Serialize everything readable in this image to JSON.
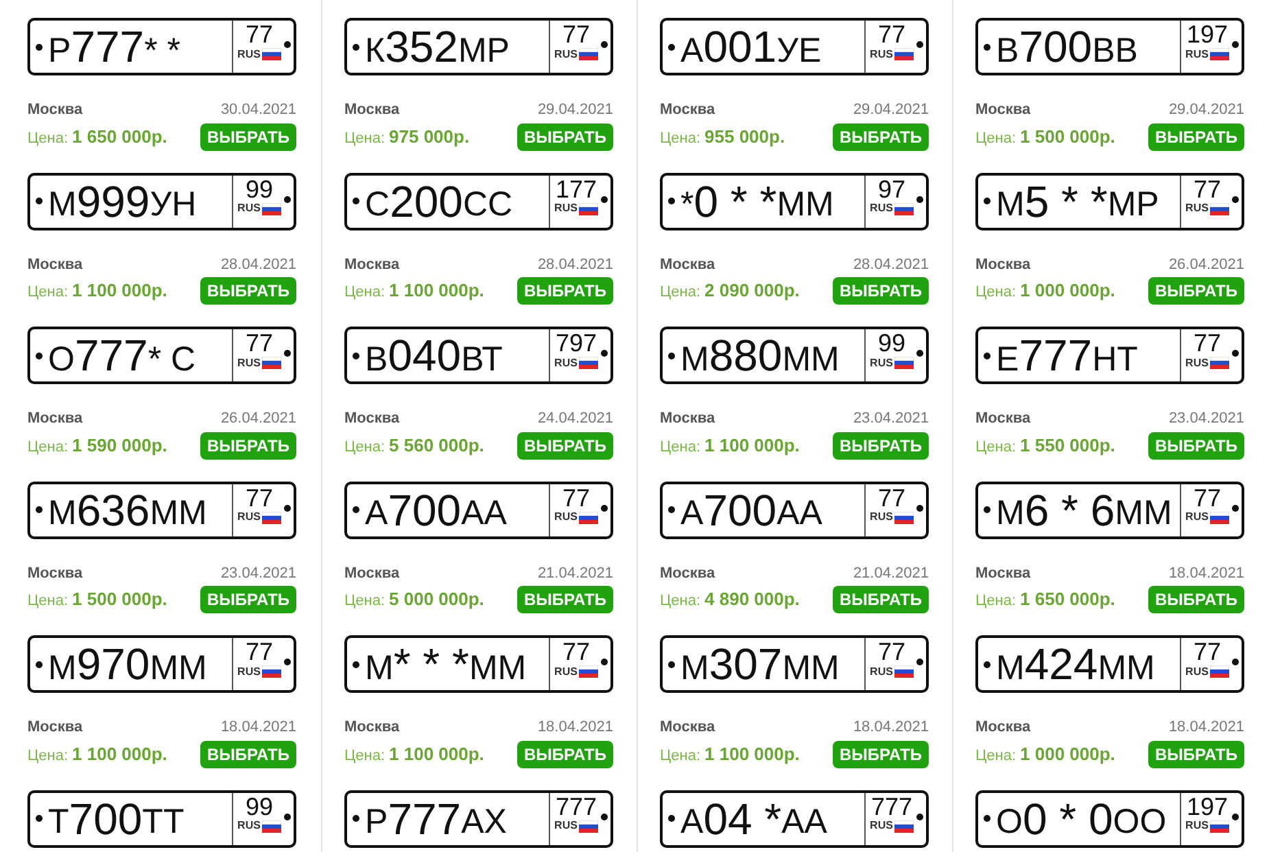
{
  "listings": [
    {
      "plate": {
        "first": "Р",
        "digits": "777",
        "last": "* *",
        "region": "77",
        "country": "RUS"
      },
      "city": "Москва",
      "date": "30.04.2021",
      "price_label": "Цена:",
      "price": "1 650 000р.",
      "button": "ВЫБРАТЬ"
    },
    {
      "plate": {
        "first": "К",
        "digits": "352",
        "last": "МР",
        "region": "77",
        "country": "RUS"
      },
      "city": "Москва",
      "date": "29.04.2021",
      "price_label": "Цена:",
      "price": "975 000р.",
      "button": "ВЫБРАТЬ"
    },
    {
      "plate": {
        "first": "А",
        "digits": "001",
        "last": "УЕ",
        "region": "77",
        "country": "RUS"
      },
      "city": "Москва",
      "date": "29.04.2021",
      "price_label": "Цена:",
      "price": "955 000р.",
      "button": "ВЫБРАТЬ"
    },
    {
      "plate": {
        "first": "В",
        "digits": "700",
        "last": "ВВ",
        "region": "197",
        "country": "RUS"
      },
      "city": "Москва",
      "date": "29.04.2021",
      "price_label": "Цена:",
      "price": "1 500 000р.",
      "button": "ВЫБРАТЬ"
    },
    {
      "plate": {
        "first": "М",
        "digits": "999",
        "last": "УН",
        "region": "99",
        "country": "RUS"
      },
      "city": "Москва",
      "date": "28.04.2021",
      "price_label": "Цена:",
      "price": "1 100 000р.",
      "button": "ВЫБРАТЬ"
    },
    {
      "plate": {
        "first": "С",
        "digits": "200",
        "last": "СС",
        "region": "177",
        "country": "RUS"
      },
      "city": "Москва",
      "date": "28.04.2021",
      "price_label": "Цена:",
      "price": "1 100 000р.",
      "button": "ВЫБРАТЬ"
    },
    {
      "plate": {
        "first": "*",
        "digits": "0 * *",
        "last": "ММ",
        "region": "97",
        "country": "RUS"
      },
      "city": "Москва",
      "date": "28.04.2021",
      "price_label": "Цена:",
      "price": "2 090 000р.",
      "button": "ВЫБРАТЬ"
    },
    {
      "plate": {
        "first": "М",
        "digits": "5 * *",
        "last": "МР",
        "region": "77",
        "country": "RUS"
      },
      "city": "Москва",
      "date": "26.04.2021",
      "price_label": "Цена:",
      "price": "1 000 000р.",
      "button": "ВЫБРАТЬ"
    },
    {
      "plate": {
        "first": "О",
        "digits": "777",
        "last": "* С",
        "region": "77",
        "country": "RUS"
      },
      "city": "Москва",
      "date": "26.04.2021",
      "price_label": "Цена:",
      "price": "1 590 000р.",
      "button": "ВЫБРАТЬ"
    },
    {
      "plate": {
        "first": "В",
        "digits": "040",
        "last": "ВТ",
        "region": "797",
        "country": "RUS"
      },
      "city": "Москва",
      "date": "24.04.2021",
      "price_label": "Цена:",
      "price": "5 560 000р.",
      "button": "ВЫБРАТЬ"
    },
    {
      "plate": {
        "first": "М",
        "digits": "880",
        "last": "ММ",
        "region": "99",
        "country": "RUS"
      },
      "city": "Москва",
      "date": "23.04.2021",
      "price_label": "Цена:",
      "price": "1 100 000р.",
      "button": "ВЫБРАТЬ"
    },
    {
      "plate": {
        "first": "Е",
        "digits": "777",
        "last": "НТ",
        "region": "77",
        "country": "RUS"
      },
      "city": "Москва",
      "date": "23.04.2021",
      "price_label": "Цена:",
      "price": "1 550 000р.",
      "button": "ВЫБРАТЬ"
    },
    {
      "plate": {
        "first": "М",
        "digits": "636",
        "last": "ММ",
        "region": "77",
        "country": "RUS"
      },
      "city": "Москва",
      "date": "23.04.2021",
      "price_label": "Цена:",
      "price": "1 500 000р.",
      "button": "ВЫБРАТЬ"
    },
    {
      "plate": {
        "first": "А",
        "digits": "700",
        "last": "АА",
        "region": "77",
        "country": "RUS"
      },
      "city": "Москва",
      "date": "21.04.2021",
      "price_label": "Цена:",
      "price": "5 000 000р.",
      "button": "ВЫБРАТЬ"
    },
    {
      "plate": {
        "first": "А",
        "digits": "700",
        "last": "АА",
        "region": "77",
        "country": "RUS"
      },
      "city": "Москва",
      "date": "21.04.2021",
      "price_label": "Цена:",
      "price": "4 890 000р.",
      "button": "ВЫБРАТЬ"
    },
    {
      "plate": {
        "first": "М",
        "digits": "6 * 6",
        "last": "ММ",
        "region": "77",
        "country": "RUS"
      },
      "city": "Москва",
      "date": "18.04.2021",
      "price_label": "Цена:",
      "price": "1 650 000р.",
      "button": "ВЫБРАТЬ"
    },
    {
      "plate": {
        "first": "М",
        "digits": "970",
        "last": "ММ",
        "region": "77",
        "country": "RUS"
      },
      "city": "Москва",
      "date": "18.04.2021",
      "price_label": "Цена:",
      "price": "1 100 000р.",
      "button": "ВЫБРАТЬ"
    },
    {
      "plate": {
        "first": "М",
        "digits": "* * *",
        "last": "ММ",
        "region": "77",
        "country": "RUS"
      },
      "city": "Москва",
      "date": "18.04.2021",
      "price_label": "Цена:",
      "price": "1 100 000р.",
      "button": "ВЫБРАТЬ"
    },
    {
      "plate": {
        "first": "М",
        "digits": "307",
        "last": "ММ",
        "region": "77",
        "country": "RUS"
      },
      "city": "Москва",
      "date": "18.04.2021",
      "price_label": "Цена:",
      "price": "1 100 000р.",
      "button": "ВЫБРАТЬ"
    },
    {
      "plate": {
        "first": "М",
        "digits": "424",
        "last": "ММ",
        "region": "77",
        "country": "RUS"
      },
      "city": "Москва",
      "date": "18.04.2021",
      "price_label": "Цена:",
      "price": "1 000 000р.",
      "button": "ВЫБРАТЬ"
    },
    {
      "plate": {
        "first": "Т",
        "digits": "700",
        "last": "ТТ",
        "region": "99",
        "country": "RUS"
      }
    },
    {
      "plate": {
        "first": "Р",
        "digits": "777",
        "last": "АХ",
        "region": "777",
        "country": "RUS"
      }
    },
    {
      "plate": {
        "first": "А",
        "digits": "04 *",
        "last": "АА",
        "region": "777",
        "country": "RUS"
      }
    },
    {
      "plate": {
        "first": "О",
        "digits": "0 * 0",
        "last": "ОО",
        "region": "197",
        "country": "RUS"
      }
    }
  ]
}
